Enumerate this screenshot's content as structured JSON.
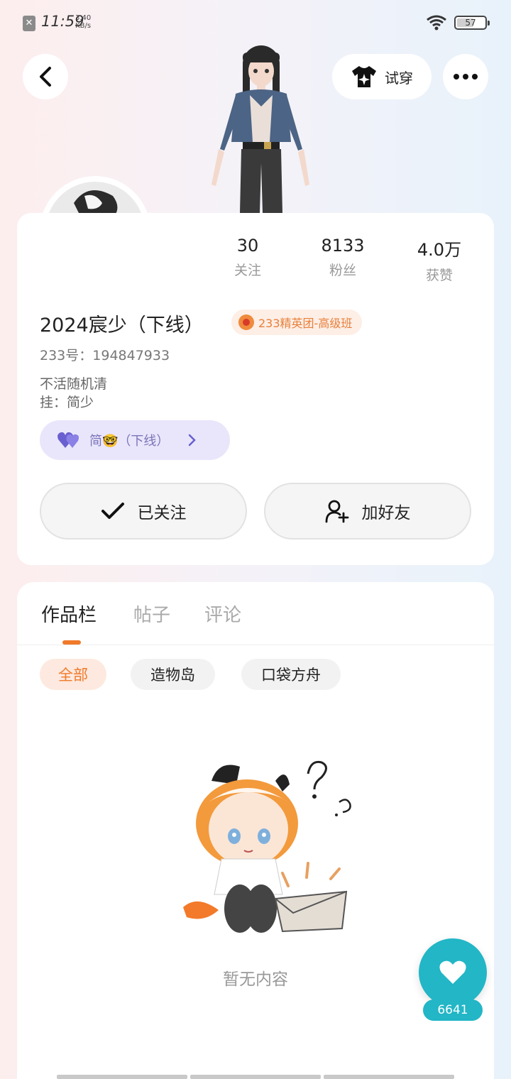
{
  "status_bar": {
    "time": "11:59",
    "speed_value": "3.40",
    "speed_unit": "KB/s",
    "battery": "57"
  },
  "header": {
    "tryon_label": "试穿"
  },
  "stats": [
    {
      "value": "30",
      "label": "关注"
    },
    {
      "value": "8133",
      "label": "粉丝"
    },
    {
      "value": "4.0万",
      "label": "获赞"
    }
  ],
  "profile": {
    "username": "2024宸少（下线）",
    "badge": "233精英团-高级班",
    "uid": "233号：194847933",
    "bio_line1": "不活随机清",
    "bio_line2": "挂：简少",
    "cp_label": "简🤓（下线）"
  },
  "actions": {
    "followed_label": "已关注",
    "add_friend_label": "加好友"
  },
  "tabs": [
    {
      "label": "作品栏"
    },
    {
      "label": "帖子"
    },
    {
      "label": "评论"
    }
  ],
  "filters": [
    {
      "label": "全部"
    },
    {
      "label": "造物岛"
    },
    {
      "label": "口袋方舟"
    }
  ],
  "empty_state": {
    "text": "暂无内容"
  },
  "like_fab": {
    "count": "6641"
  },
  "colors": {
    "accent_orange": "#f07a2a",
    "like_teal": "#22b6c6",
    "cp_purple": "#7b74b8"
  }
}
